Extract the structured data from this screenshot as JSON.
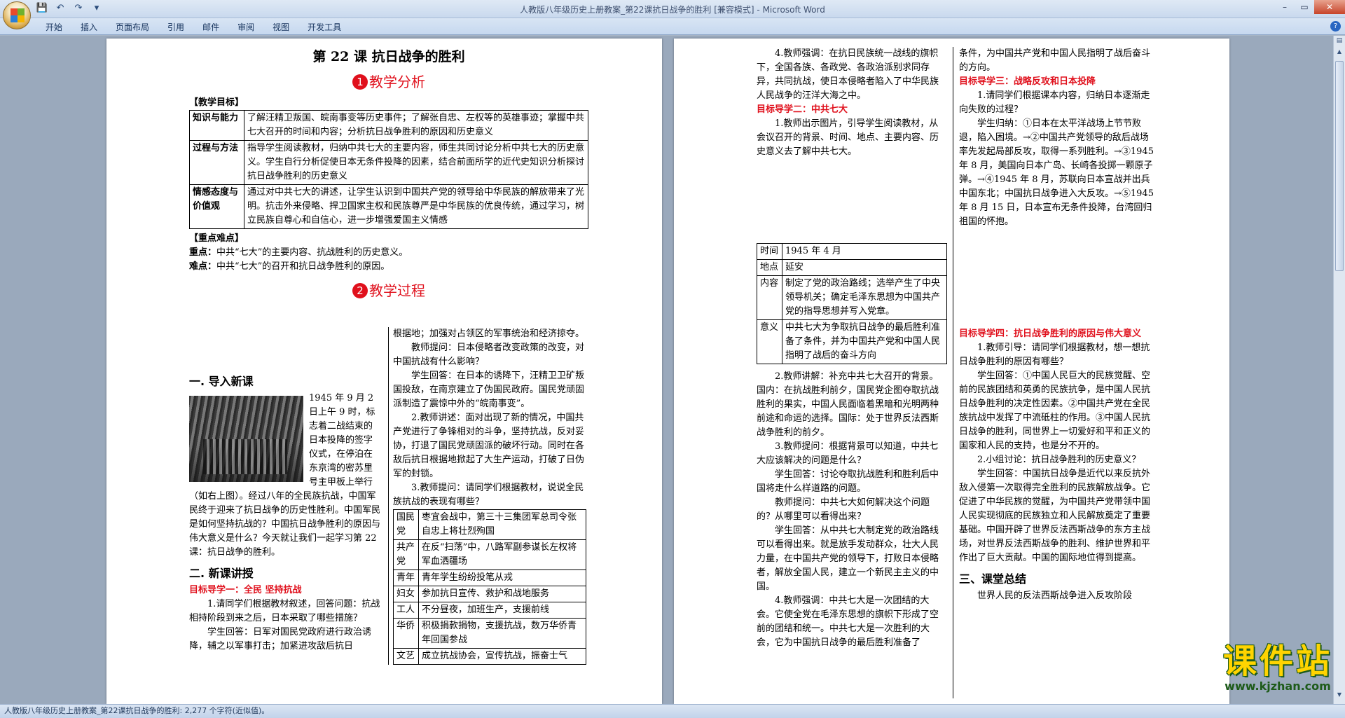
{
  "window": {
    "title": "人教版八年级历史上册教案_第22课抗日战争的胜利 [兼容模式] - Microsoft Word"
  },
  "qat": {
    "save_icon": "💾",
    "undo_icon": "↶",
    "redo_icon": "↷",
    "more_icon": "▾"
  },
  "ribbon": {
    "tabs": [
      "开始",
      "插入",
      "页面布局",
      "引用",
      "邮件",
      "审阅",
      "视图",
      "开发工具"
    ],
    "help": "?"
  },
  "window_controls": {
    "minimize": "–",
    "restore": "▭",
    "close": "✕"
  },
  "statusbar": {
    "text": "人教版八年级历史上册教案_第22课抗日战争的胜利: 2,277 个字符(近似值)。"
  },
  "watermark": {
    "cn": "课件站",
    "url": "www.kjzhan.com"
  },
  "page1": {
    "lesson_title": "第 22 课    抗日战争的胜利",
    "section1": {
      "num": "1",
      "label": "教学分析"
    },
    "goals_heading": "【教学目标】",
    "goals": [
      {
        "label": "知识与能力",
        "text": "了解汪精卫叛国、皖南事变等历史事件；了解张自忠、左权等的英雄事迹；掌握中共七大召开的时间和内容；分析抗日战争胜利的原因和历史意义"
      },
      {
        "label": "过程与方法",
        "text": "指导学生阅读教材，归纳中共七大的主要内容，师生共同讨论分析中共七大的历史意义。学生自行分析促使日本无条件投降的因素，结合前面所学的近代史知识分析探讨抗日战争胜利的历史意义"
      },
      {
        "label": "情感态度与价值观",
        "text": "通过对中共七大的讲述，让学生认识到中国共产党的领导给中华民族的解放带来了光明。抗击外来侵略、捍卫国家主权和民族尊严是中华民族的优良传统，通过学习，树立民族自尊心和自信心，进一步增强爱国主义情感"
      }
    ],
    "key_heading": "【重点难点】",
    "key_point_label": "重点：",
    "key_point": "中共“七大”的主要内容、抗战胜利的历史意义。",
    "difficulty_label": "难点：",
    "difficulty": "中共“七大”的召开和抗日战争胜利的原因。",
    "section2": {
      "num": "2",
      "label": "教学过程"
    },
    "intro_heading": "一. 导入新课",
    "intro_text": "1945 年 9 月 2 日上午 9 时，标志着二战结束的日本投降的签字仪式，在停泊在东京湾的密苏里号主甲板上举行（如右上图）。经过八年的全民族抗战，中国军民终于迎来了抗日战争的历史性胜利。中国军民是如何坚持抗战的？中国抗日战争胜利的原因与伟大意义是什么？今天就让我们一起学习第 22 课：抗日战争的胜利。",
    "new_heading": "二. 新课讲授",
    "target1": "目标导学一：全民 坚持抗战",
    "t1_q": "1.请同学们根据教材叙述，回答问题：抗战相持阶段到来之后，日本采取了哪些措施？",
    "t1_a": "学生回答：日军对国民党政府进行政治诱降，辅之以军事打击；加紧进攻敌后抗日",
    "right_col_1": "根据地；加强对占领区的军事统治和经济掠夺。",
    "right_col_2": "教师提问：日本侵略者改变政策的改变，对中国抗战有什么影响？",
    "right_col_3": "学生回答：在日本的诱降下，汪精卫卫矿叛国投敌，在南京建立了伪国民政府。国民党顽固派制造了震惊中外的“皖南事变”。",
    "right_col_4": "2.教师讲述：面对出现了新的情况，中国共产党进行了争锋相对的斗争，坚持抗战，反对妥协，打退了国民党顽固派的破坏行动。同时在各敌后抗日根据地掀起了大生产运动，打破了日伪军的封锁。",
    "right_col_5": "3.教师提问：请同学们根据教材，说说全民族抗战的表现有哪些？",
    "resistance_table": [
      {
        "label": "国民党",
        "text": "枣宜会战中，第三十三集团军总司令张自忠上将壮烈殉国"
      },
      {
        "label": "共产党",
        "text": "在反“扫荡”中，八路军副参谋长左权将军血洒疆场"
      },
      {
        "label": "青年",
        "text": "青年学生纷纷投笔从戎"
      },
      {
        "label": "妇女",
        "text": "参加抗日宣传、救护和战地服务"
      },
      {
        "label": "工人",
        "text": "不分昼夜，加班生产，支援前线"
      },
      {
        "label": "华侨",
        "text": "积极捐款捐物，支援抗战，数万华侨青年回国参战"
      },
      {
        "label": "文艺",
        "text": "成立抗战协会，宣传抗战，振奋士气"
      }
    ]
  },
  "page2": {
    "c1_1": "4.教师强调：在抗日民族统一战线的旗帜下，全国各族、各政党、各政治派别求同存异，共同抗战，使日本侵略者陷入了中华民族人民战争的汪洋大海之中。",
    "target2": "目标导学二：中共七大",
    "c1_2": "1.教师出示图片，引导学生阅读教材，从会议召开的背景、时间、地点、主要内容、历史意义去了解中共七大。",
    "congress_table": [
      {
        "label": "时间",
        "text": "1945 年 4 月"
      },
      {
        "label": "地点",
        "text": "延安"
      },
      {
        "label": "内容",
        "text": "制定了党的政治路线；选举产生了中央领导机关；确定毛泽东思想为中国共产党的指导思想并写入党章。"
      },
      {
        "label": "意义",
        "text": "中共七大为争取抗日战争的最后胜利准备了条件，并为中国共产党和中国人民指明了战后的奋斗方向"
      }
    ],
    "c1_3": "2.教师讲解：补充中共七大召开的背景。国内：在抗战胜利前夕，国民党企图夺取抗战胜利的果实，中国人民面临着黑暗和光明两种前途和命运的选择。国际：处于世界反法西斯战争胜利的前夕。",
    "c1_4": "3.教师提问：根据背景可以知道，中共七大应该解决的问题是什么？",
    "c1_5": "学生回答：讨论夺取抗战胜利和胜利后中国将走什么样道路的问题。",
    "c1_6": "教师提问：中共七大如何解决这个问题的？从哪里可以看得出来？",
    "c1_7": "学生回答：从中共七大制定党的政治路线可以看得出来。就是放手发动群众，壮大人民力量，在中国共产党的领导下，打败日本侵略者，解放全国人民，建立一个新民主主义的中国。",
    "c1_8": "4.教师强调：中共七大是一次团结的大会。它使全党在毛泽东思想的旗帜下形成了空前的团结和统一。中共七大是一次胜利的大会，它为中国抗日战争的最后胜利准备了",
    "c2_1": "条件，为中国共产党和中国人民指明了战后奋斗的方向。",
    "target3": "目标导学三：战略反攻和日本投降",
    "c2_2": "1.请同学们根据课本内容，归纳日本逐渐走向失败的过程？",
    "c2_3": "学生归纳：①日本在太平洋战场上节节败退，陷入困境。→②中国共产党领导的敌后战场率先发起局部反攻，取得一系列胜利。→③1945 年 8 月，美国向日本广岛、长崎各投掷一颗原子弹。→④1945 年 8 月，苏联向日本宣战并出兵中国东北；中国抗日战争进入大反攻。→⑤1945 年 8 月 15 日，日本宣布无条件投降，台湾回归祖国的怀抱。",
    "target4": "目标导学四：抗日战争胜利的原因与伟大意义",
    "c2_4": "1.教师引导：请同学们根据教材，想一想抗日战争胜利的原因有哪些？",
    "c2_5": "学生回答：①中国人民巨大的民族觉醒、空前的民族团结和英勇的民族抗争，是中国人民抗日战争胜利的决定性因素。②中国共产党在全民族抗战中发挥了中流砥柱的作用。③中国人民抗日战争的胜利，同世界上一切爱好和平和正义的国家和人民的支持，也是分不开的。",
    "c2_6": "2.小组讨论：抗日战争胜利的历史意义？",
    "c2_7": "学生回答：中国抗日战争是近代以来反抗外敌入侵第一次取得完全胜利的民族解放战争。它促进了中华民族的觉醒，为中国共产党带领中国人民实现彻底的民族独立和人民解放奠定了重要基础。中国开辟了世界反法西斯战争的东方主战场，对世界反法西斯战争的胜利、维护世界和平作出了巨大贡献。中国的国际地位得到提高。",
    "summary_heading": "三、课堂总结",
    "c2_8": "世界人民的反法西斯战争进入反攻阶段"
  }
}
